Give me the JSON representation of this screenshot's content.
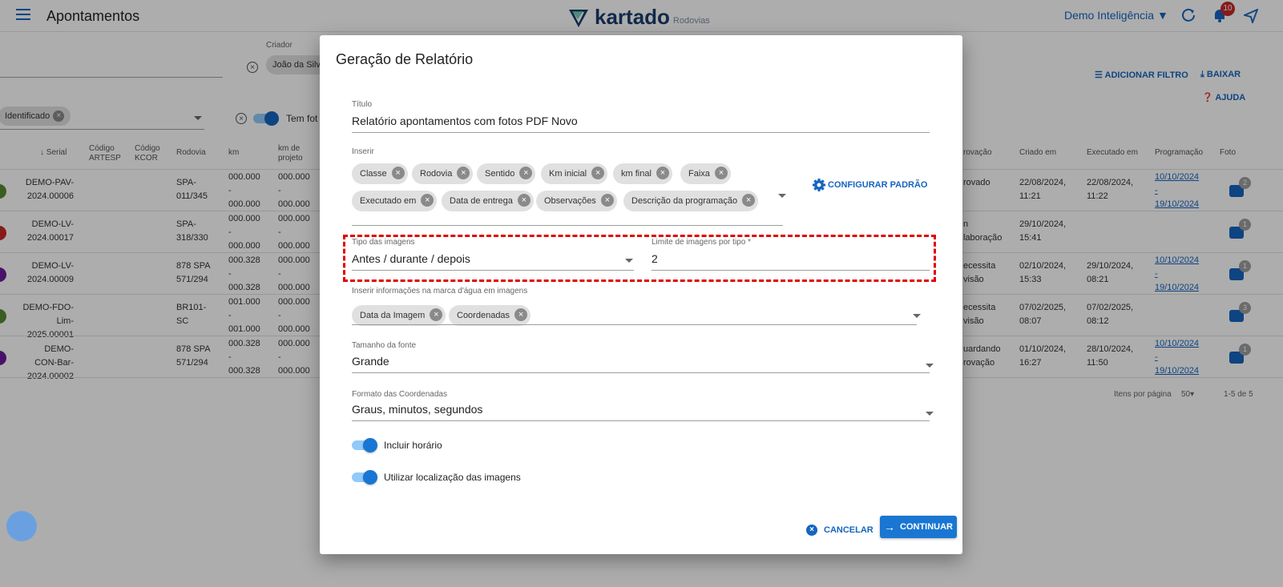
{
  "header": {
    "title": "Apontamentos",
    "logo_text": "kartado",
    "logo_sub": "Rodovias",
    "org_selector": "Demo Inteligência ▼",
    "notification_count": "10"
  },
  "background": {
    "filter_creator_label": "Criador",
    "filter_creator_value": "João da Silv",
    "status_chip": "Identificado",
    "toggle_photo_label": "Tem fot",
    "add_filter": "ADICIONAR FILTRO",
    "download": "BAIXAR",
    "help": "AJUDA",
    "columns": {
      "serial": "↓ Serial",
      "artesp": "Código ARTESP",
      "kcor": "Código KCOR",
      "rodovia": "Rodovia",
      "km": "km",
      "km_projeto": "km de projeto",
      "aprovacao": "rovação",
      "criado_em": "Criado em",
      "executado_em": "Executado em",
      "programacao": "Programação",
      "foto": "Foto"
    },
    "rows": [
      {
        "serial": "DEMO-PAV-\n2024.00006",
        "rodovia": "SPA-\n011/345",
        "km": "000.000\n-\n000.000",
        "kmp": "000.000\n-\n000.000",
        "aprov": "rovado",
        "criado": "22/08/2024,\n11:21",
        "exec": "22/08/2024,\n11:22",
        "prog_a": "10/10/2024",
        "prog_b": "-",
        "prog_c": "19/10/2024",
        "fotos": "2",
        "color": "#558b2f"
      },
      {
        "serial": "DEMO-LV-\n2024.00017",
        "rodovia": "SPA-\n318/330",
        "km": "000.000\n-\n000.000",
        "kmp": "000.000\n-\n000.000",
        "aprov": "n\nlaboração",
        "criado": "29/10/2024,\n15:41",
        "exec": "",
        "prog_a": "",
        "prog_b": "",
        "prog_c": "",
        "fotos": "1",
        "color": "#c62828"
      },
      {
        "serial": "DEMO-LV-\n2024.00009",
        "rodovia": "878 SPA\n571/294",
        "km": "000.328\n-\n000.328",
        "kmp": "000.000\n-\n000.000",
        "aprov": "ecessita\nvisão",
        "criado": "02/10/2024,\n15:33",
        "exec": "29/10/2024,\n08:21",
        "prog_a": "10/10/2024",
        "prog_b": "-",
        "prog_c": "19/10/2024",
        "fotos": "1",
        "color": "#6a1b9a"
      },
      {
        "serial": "DEMO-FDO-\nLim-\n2025.00001",
        "rodovia": "BR101-\nSC",
        "km": "001.000\n-\n001.000",
        "kmp": "000.000\n-\n000.000",
        "aprov": "ecessita\nvisão",
        "criado": "07/02/2025,\n08:07",
        "exec": "07/02/2025,\n08:12",
        "prog_a": "",
        "prog_b": "",
        "prog_c": "",
        "fotos": "3",
        "color": "#558b2f"
      },
      {
        "serial": "DEMO-\nCON-Bar-\n2024.00002",
        "rodovia": "878 SPA\n571/294",
        "km": "000.328\n-\n000.328",
        "kmp": "000.000\n-\n000.000",
        "aprov": "uardando\nrovação",
        "criado": "01/10/2024,\n16:27",
        "exec": "28/10/2024,\n11:50",
        "prog_a": "10/10/2024",
        "prog_b": "-",
        "prog_c": "19/10/2024",
        "fotos": "1",
        "color": "#6a1b9a"
      }
    ],
    "pagination_label": "Itens por página",
    "pagination_size": "50",
    "pagination_range": "1-5 de 5"
  },
  "dialog": {
    "title": "Geração de Relatório",
    "titulo_label": "Título",
    "titulo_value": "Relatório apontamentos com fotos PDF Novo",
    "inserir_label": "Inserir",
    "inserir_chips": [
      "Classe",
      "Rodovia",
      "Sentido",
      "Km inicial",
      "km final",
      "Faixa",
      "Executado em",
      "Data de entrega",
      "Observações",
      "Descrição da programação"
    ],
    "config_button": "CONFIGURAR PADRÃO",
    "tipo_label": "Tipo das imagens",
    "tipo_value": "Antes / durante / depois",
    "limite_label": "Limite de imagens por tipo *",
    "limite_value": "2",
    "marca_label": "Inserir informações na marca d'água em imagens",
    "marca_chips": [
      "Data da Imagem",
      "Coordenadas"
    ],
    "fonte_label": "Tamanho da fonte",
    "fonte_value": "Grande",
    "coord_label": "Formato das Coordenadas",
    "coord_value": "Graus, minutos, segundos",
    "toggle_horario": "Incluir horário",
    "toggle_localizacao": "Utilizar localização das imagens",
    "cancel_label": "CANCELAR",
    "continue_label": "CONTINUAR",
    "accent_color": "#1976d2",
    "highlight_color": "#e00000"
  }
}
